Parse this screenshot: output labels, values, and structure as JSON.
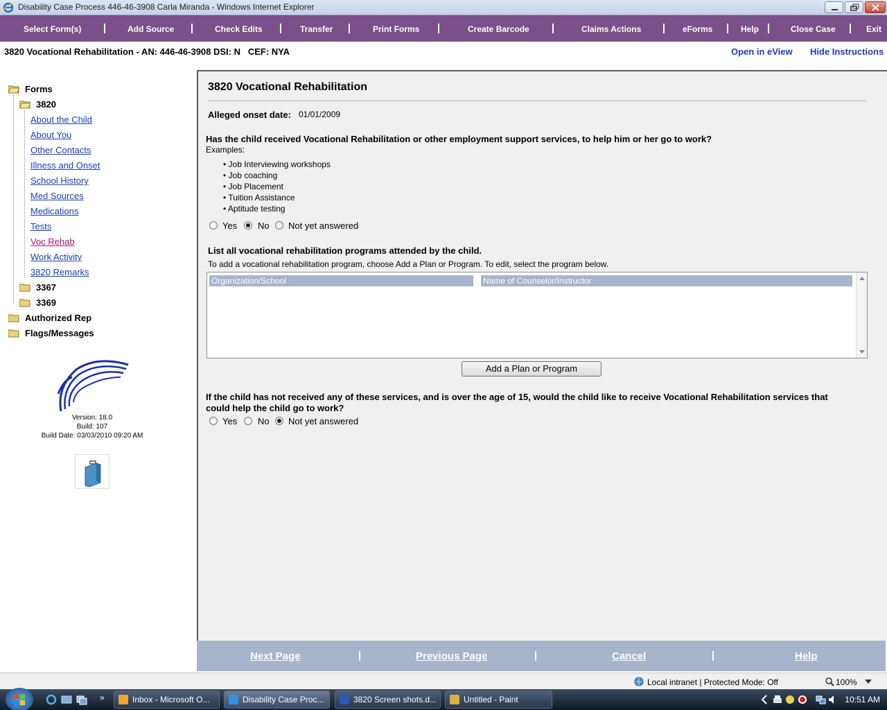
{
  "window": {
    "title": "Disability Case Process 446-46-3908 Carla Miranda - Windows Internet Explorer"
  },
  "menu": {
    "items": [
      "Select Form(s)",
      "Add Source",
      "Check Edits",
      "Transfer",
      "Print Forms",
      "Create Barcode",
      "Claims Actions",
      "eForms",
      "Help",
      "Close Case",
      "Exit"
    ]
  },
  "case_header": {
    "title": "3820 Vocational Rehabilitation - AN: 446-46-3908 DSI: N   CEF: NYA",
    "open_eview": "Open in eView",
    "hide_instructions": "Hide Instructions"
  },
  "tree": {
    "forms": "Forms",
    "f3820": "3820",
    "links": [
      "About the Child",
      "About You",
      "Other Contacts",
      "Illness and Onset",
      "School History",
      "Med Sources",
      "Medications",
      "Tests",
      "Voc Rehab",
      "Work Activity",
      "3820 Remarks"
    ],
    "f3367": "3367",
    "f3369": "3369",
    "authorized_rep": "Authorized Rep",
    "flags_messages": "Flags/Messages"
  },
  "version": {
    "version": "Version: 18.0",
    "build": "Build: 107",
    "build_date": "Build Date: 03/03/2010 09:20 AM"
  },
  "main": {
    "form_title": "3820 Vocational Rehabilitation",
    "onset_label": "Alleged onset date:",
    "onset_value": "01/01/2009",
    "q1": "Has the child received Vocational Rehabilitation or other employment support services, to help him or her go to work?",
    "examples_label": "Examples:",
    "examples": [
      "Job Interviewing workshops",
      "Job coaching",
      "Job Placement",
      "Tuition Assistance",
      "Aptitude testing"
    ],
    "q1_options": [
      "Yes",
      "No",
      "Not yet answered"
    ],
    "q1_selected": "No",
    "list_heading": "List all vocational rehabilitation programs attended by the child.",
    "list_instructions": "To add a vocational rehabilitation program, choose Add a Plan or Program. To edit, select the program below.",
    "grid_columns": [
      "Organization/School",
      "Name of Counselor/Instructor"
    ],
    "add_button": "Add a Plan or Program",
    "q2_line1": "If the child has not received any of these services, and is over the age of 15, would the child like to receive Vocational Rehabilitation services that",
    "q2_line2": "could help the child go to work?",
    "q2_options": [
      "Yes",
      "No",
      "Not yet answered"
    ],
    "q2_selected": "Not yet answered"
  },
  "bottom_nav": {
    "next": "Next Page",
    "previous": "Previous Page",
    "cancel": "Cancel",
    "help": "Help"
  },
  "status": {
    "zone": "Local intranet | Protected Mode: Off",
    "zoom": "100%"
  },
  "taskbar": {
    "items": [
      "Inbox - Microsoft O...",
      "Disability Case Proc...",
      "3820 Screen shots.d...",
      "Untitled - Paint"
    ],
    "clock": "10:51 AM"
  },
  "colors": {
    "menu_bg": "#7b4f8a",
    "link": "#1a3eb8",
    "active_link": "#b0147a",
    "nav_bg": "#a6b4cc"
  }
}
